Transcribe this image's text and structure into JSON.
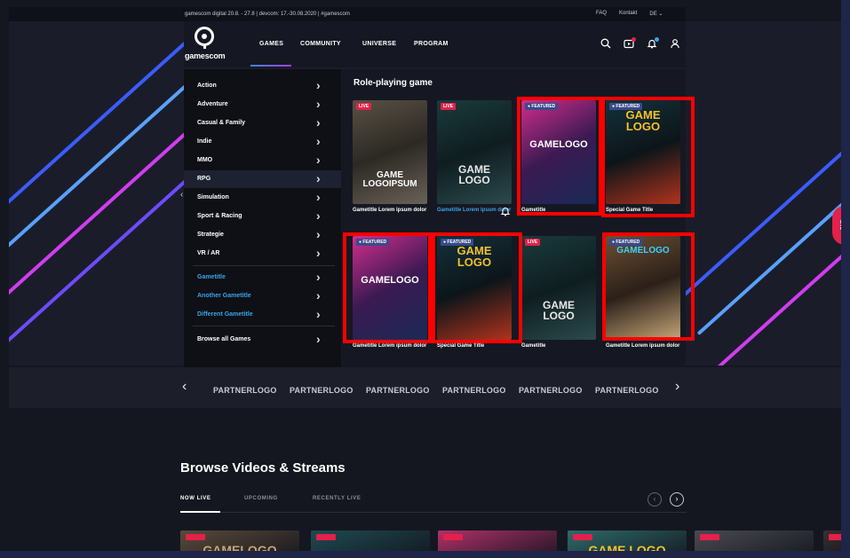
{
  "topbar": {
    "info": "gamescom digital 20.8. - 27.8  |  devcom: 17.-30.08.2020  |  #gamescom",
    "faq": "FAQ",
    "kontakt": "Kontakt",
    "lang": "DE ⌄"
  },
  "logo": {
    "word": "gamescom"
  },
  "nav": {
    "games": "GAMES",
    "community": "COMMUNITY",
    "universe": "UNIVERSE",
    "program": "PROGRAM"
  },
  "icons": {
    "search": "search-icon",
    "video": "video-icon",
    "bell": "bell-icon",
    "user": "user-icon"
  },
  "menu": {
    "categories": [
      "Action",
      "Adventure",
      "Casual & Family",
      "Indie",
      "MMO",
      "RPG",
      "Simulation",
      "Sport & Racing",
      "Strategie",
      "VR / AR"
    ],
    "featured": [
      "Gametitle",
      "Another Gametitle",
      "Different Gametitle"
    ],
    "browse_all": "Browse all Games",
    "chevron": "›"
  },
  "panel": {
    "title": "Role-playing game",
    "cards": [
      {
        "badge": "LIVE",
        "logo": "GAME\nLOGOIPSUM",
        "title": "Gametitle Lorem ipsum dolor"
      },
      {
        "badge": "LIVE",
        "logo": "GAME\nLOGO",
        "title": "Gametitle Lorem ipsum dolor"
      },
      {
        "badge": "● FEATURED",
        "logo": "GAMELOGO",
        "title": "Gametitle"
      },
      {
        "badge": "● FEATURED",
        "logo": "GAME\nLOGO",
        "title": "Special Game Title"
      },
      {
        "badge": "● FEATURED",
        "logo": "GAMELOGO",
        "title": "Gametitle Lorem ipsum dolor"
      },
      {
        "badge": "● FEATURED",
        "logo": "GAME\nLOGO",
        "title": "Special Game Title"
      },
      {
        "badge": "LIVE",
        "logo": "GAME\nLOGO",
        "title": "Gametitle"
      },
      {
        "badge": "● FEATURED",
        "logo": "GAMELOGO",
        "title": "Gametitle Lorem ipsum dolor"
      }
    ]
  },
  "partners": {
    "items": [
      "PARTNERLOGO",
      "PARTNERLOGO",
      "PARTNERLOGO",
      "PARTNERLOGO",
      "PARTNERLOGO",
      "PARTNERLOGO"
    ],
    "prev": "‹",
    "next": "›"
  },
  "browse": {
    "title": "Browse Videos & Streams",
    "tabs": [
      "NOW LIVE",
      "UPCOMING",
      "RECENTLY LIVE"
    ],
    "prev": "‹",
    "next": "›",
    "thumb_logos": [
      "GAMELOGO",
      "",
      "",
      "GAME LOGO",
      "",
      ""
    ]
  },
  "side_tab": "LIVE"
}
